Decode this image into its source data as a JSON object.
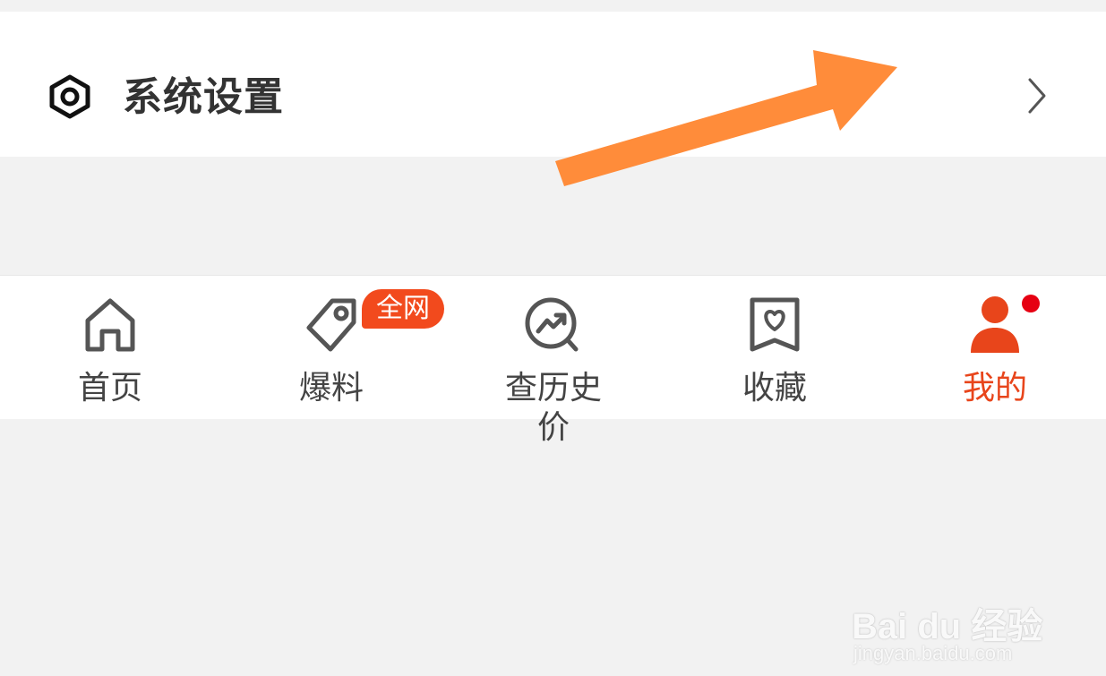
{
  "settings": {
    "label": "系统设置",
    "icon": "hexagon-settings-icon",
    "chevron_icon": "chevron-right-icon"
  },
  "annotation": {
    "icon": "orange-arrow-pointer",
    "color": "#ff8c3a"
  },
  "tabbar": {
    "tabs": [
      {
        "label": "首页",
        "icon": "home-icon",
        "active": false
      },
      {
        "label": "爆料",
        "icon": "tag-icon",
        "active": false,
        "badge": "全网"
      },
      {
        "label": "查历史价",
        "icon": "price-trend-icon",
        "active": false
      },
      {
        "label": "收藏",
        "icon": "bookmark-heart-icon",
        "active": false
      },
      {
        "label": "我的",
        "icon": "user-icon",
        "active": true,
        "notification_dot": true
      }
    ]
  },
  "colors": {
    "accent": "#e8451b",
    "badge": "#f24a1d",
    "text": "#333333",
    "background": "#f2f2f2"
  },
  "watermark": {
    "brand": "Bai du 经验",
    "url": "jingyan.baidu.com"
  }
}
